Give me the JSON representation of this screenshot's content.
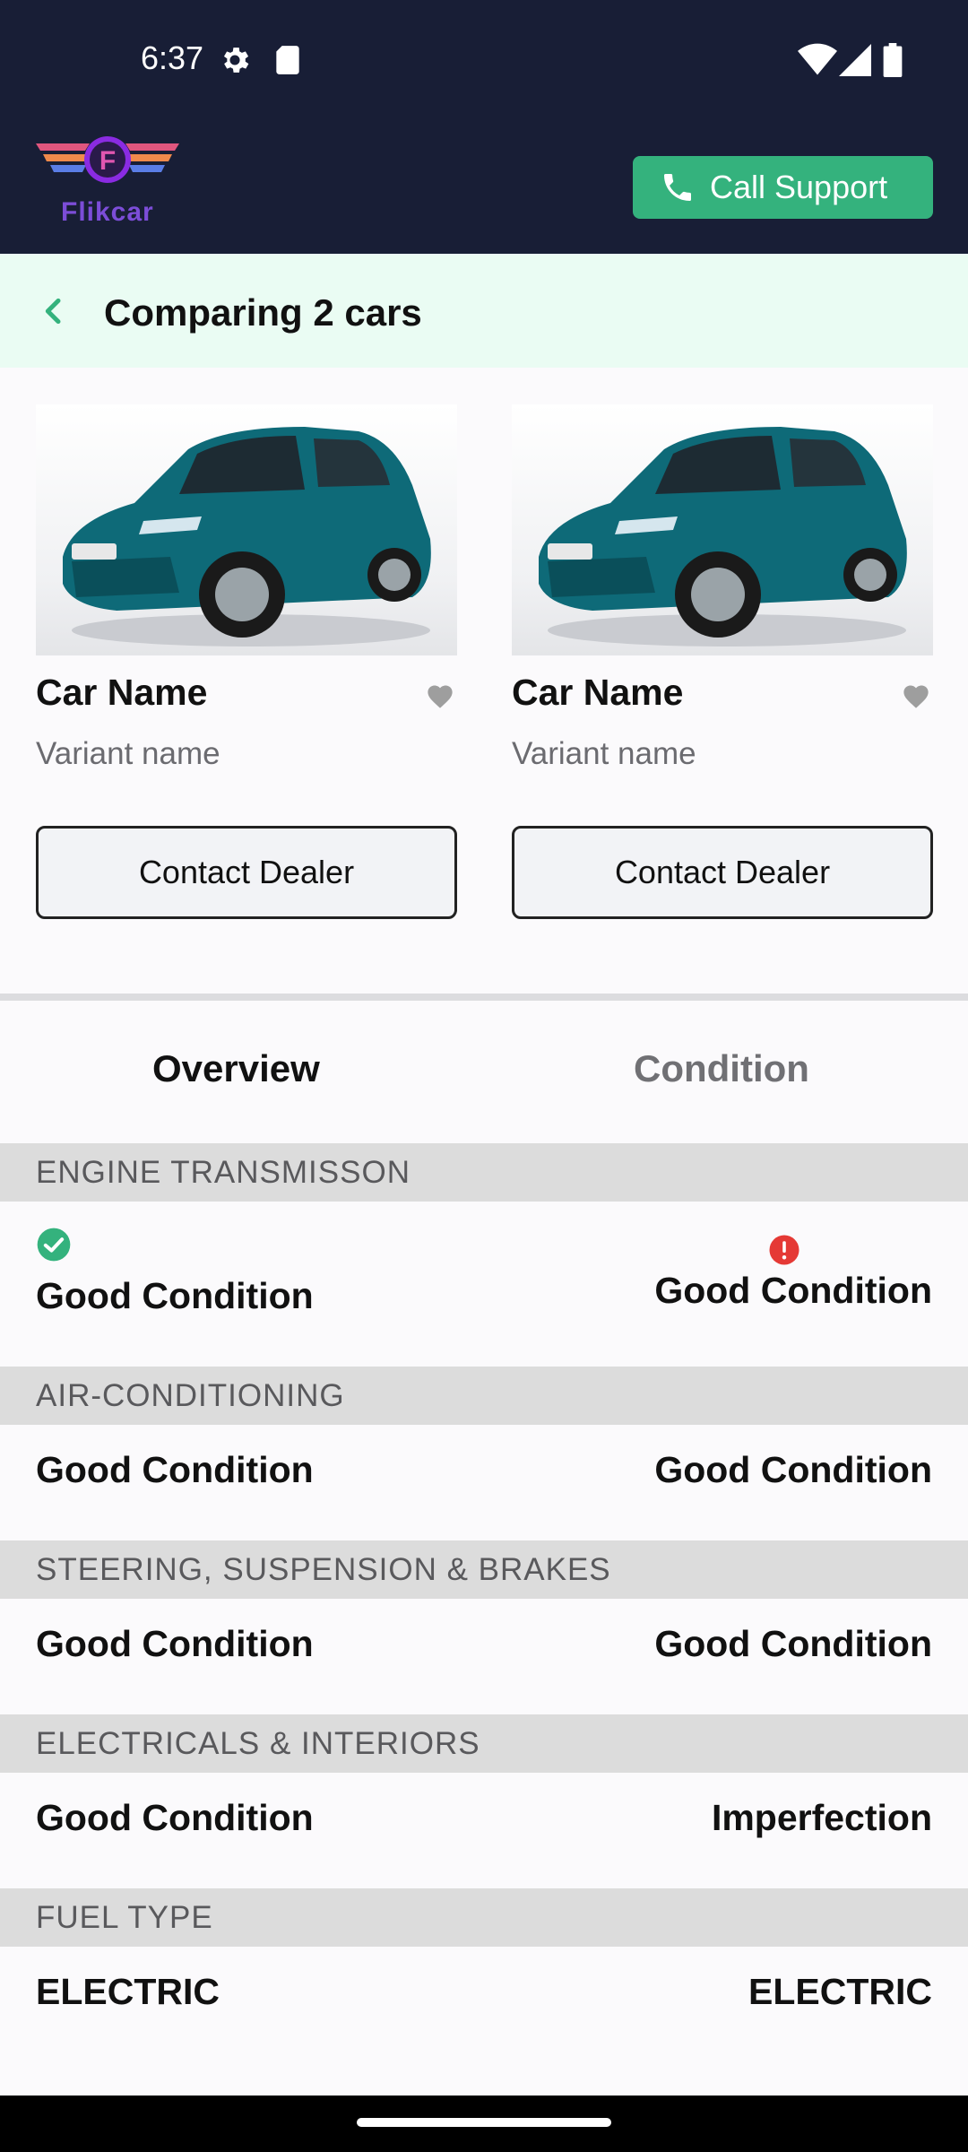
{
  "status_bar": {
    "time": "6:37"
  },
  "header": {
    "logo_text": "Flikcar",
    "call_support_label": "Call Support"
  },
  "title_bar": {
    "title": "Comparing 2 cars"
  },
  "cars": [
    {
      "name": "Car Name",
      "variant": "Variant name",
      "contact_label": "Contact Dealer"
    },
    {
      "name": "Car Name",
      "variant": "Variant name",
      "contact_label": "Contact Dealer"
    }
  ],
  "tabs": [
    {
      "label": "Overview",
      "active": true
    },
    {
      "label": "Condition",
      "active": false
    }
  ],
  "sections": [
    {
      "title": "ENGINE TRANSMISSON",
      "left": "Good Condition",
      "right": "Good Condition",
      "left_status": "ok",
      "right_status": "warning"
    },
    {
      "title": "AIR-CONDITIONING",
      "left": "Good Condition",
      "right": "Good Condition"
    },
    {
      "title": "STEERING, SUSPENSION & BRAKES",
      "left": "Good Condition",
      "right": "Good Condition"
    },
    {
      "title": "ELECTRICALS & INTERIORS",
      "left": "Good Condition",
      "right": "Imperfection"
    },
    {
      "title": "FUEL TYPE",
      "left": "ELECTRIC",
      "right": "ELECTRIC"
    }
  ],
  "colors": {
    "header_bg": "#181e36",
    "accent_green": "#34b27d",
    "title_bar_bg": "#eafcf3",
    "warning_red": "#e53935"
  },
  "icons": [
    "settings-icon",
    "sd-card-icon",
    "wifi-icon",
    "signal-icon",
    "battery-icon",
    "phone-icon",
    "back-arrow-icon",
    "heart-icon",
    "check-circle-icon",
    "alert-circle-icon"
  ]
}
